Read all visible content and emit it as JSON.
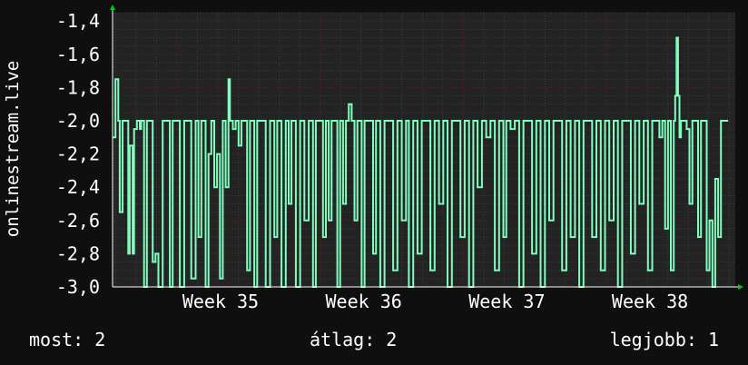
{
  "colors": {
    "background": "#0f0f0f",
    "plot_background": "#232323",
    "grid_major": "#5a1e1e",
    "grid_minor": "#3c3c3c",
    "series": "#7fffbf",
    "axis_arrow": "#00cc00",
    "text": "#ffffff"
  },
  "chart_data": {
    "type": "line",
    "title": "",
    "ylabel": "onlinestream.live",
    "xlabel": "",
    "ylim": [
      -3.0,
      -1.35
    ],
    "yticks": [
      -3.0,
      -2.8,
      -2.6,
      -2.4,
      -2.2,
      -2.0,
      -1.8,
      -1.6,
      -1.4
    ],
    "ytick_labels": [
      "-3,0",
      "-2,8",
      "-2,6",
      "-2,4",
      "-2,2",
      "-2,0",
      "-1,8",
      "-1,6",
      "-1,4"
    ],
    "xlim": [
      34.55,
      38.9
    ],
    "xticks": [
      35,
      36,
      37,
      38
    ],
    "xtick_labels": [
      "Week 35",
      "Week 36",
      "Week 37",
      "Week 38"
    ],
    "grid": true,
    "series": [
      {
        "values": [
          [
            34.55,
            -2.1
          ],
          [
            34.57,
            -1.75
          ],
          [
            34.59,
            -2.0
          ],
          [
            34.6,
            -2.55
          ],
          [
            34.62,
            -2.0
          ],
          [
            34.64,
            -2.0
          ],
          [
            34.66,
            -2.8
          ],
          [
            34.67,
            -2.15
          ],
          [
            34.69,
            -2.8
          ],
          [
            34.7,
            -2.05
          ],
          [
            34.72,
            -2.0
          ],
          [
            34.74,
            -2.05
          ],
          [
            34.75,
            -2.0
          ],
          [
            34.77,
            -3.0
          ],
          [
            34.79,
            -2.0
          ],
          [
            34.81,
            -2.0
          ],
          [
            34.83,
            -2.85
          ],
          [
            34.85,
            -2.8
          ],
          [
            34.87,
            -3.0
          ],
          [
            34.9,
            -2.0
          ],
          [
            34.92,
            -2.0
          ],
          [
            34.95,
            -3.0
          ],
          [
            34.97,
            -2.0
          ],
          [
            35.0,
            -2.0
          ],
          [
            35.02,
            -3.0
          ],
          [
            35.05,
            -2.0
          ],
          [
            35.08,
            -2.0
          ],
          [
            35.1,
            -2.95
          ],
          [
            35.13,
            -2.0
          ],
          [
            35.15,
            -2.7
          ],
          [
            35.17,
            -2.0
          ],
          [
            35.2,
            -3.0
          ],
          [
            35.22,
            -2.2
          ],
          [
            35.24,
            -2.0
          ],
          [
            35.26,
            -2.4
          ],
          [
            35.28,
            -2.2
          ],
          [
            35.3,
            -2.95
          ],
          [
            35.32,
            -2.0
          ],
          [
            35.34,
            -2.4
          ],
          [
            35.36,
            -1.75
          ],
          [
            35.37,
            -2.0
          ],
          [
            35.39,
            -2.05
          ],
          [
            35.41,
            -2.0
          ],
          [
            35.43,
            -2.15
          ],
          [
            35.45,
            -2.0
          ],
          [
            35.47,
            -2.0
          ],
          [
            35.49,
            -2.9
          ],
          [
            35.51,
            -2.0
          ],
          [
            35.54,
            -3.0
          ],
          [
            35.56,
            -2.0
          ],
          [
            35.59,
            -2.0
          ],
          [
            35.62,
            -3.0
          ],
          [
            35.65,
            -2.0
          ],
          [
            35.68,
            -2.7
          ],
          [
            35.7,
            -2.0
          ],
          [
            35.73,
            -3.0
          ],
          [
            35.76,
            -2.0
          ],
          [
            35.78,
            -2.5
          ],
          [
            35.8,
            -2.0
          ],
          [
            35.83,
            -3.0
          ],
          [
            35.86,
            -2.0
          ],
          [
            35.89,
            -2.6
          ],
          [
            35.92,
            -2.0
          ],
          [
            35.95,
            -3.0
          ],
          [
            35.97,
            -2.0
          ],
          [
            36.0,
            -2.0
          ],
          [
            36.02,
            -2.7
          ],
          [
            36.04,
            -2.0
          ],
          [
            36.06,
            -2.6
          ],
          [
            36.08,
            -2.0
          ],
          [
            36.1,
            -2.0
          ],
          [
            36.12,
            -3.0
          ],
          [
            36.14,
            -2.0
          ],
          [
            36.16,
            -2.5
          ],
          [
            36.18,
            -2.0
          ],
          [
            36.2,
            -1.9
          ],
          [
            36.22,
            -2.0
          ],
          [
            36.24,
            -2.6
          ],
          [
            36.26,
            -2.0
          ],
          [
            36.29,
            -3.0
          ],
          [
            36.31,
            -2.0
          ],
          [
            36.34,
            -2.0
          ],
          [
            36.37,
            -2.8
          ],
          [
            36.39,
            -2.0
          ],
          [
            36.42,
            -3.0
          ],
          [
            36.45,
            -2.0
          ],
          [
            36.48,
            -2.0
          ],
          [
            36.51,
            -2.9
          ],
          [
            36.54,
            -2.0
          ],
          [
            36.57,
            -2.6
          ],
          [
            36.6,
            -2.0
          ],
          [
            36.62,
            -3.0
          ],
          [
            36.65,
            -2.0
          ],
          [
            36.68,
            -2.8
          ],
          [
            36.71,
            -2.0
          ],
          [
            36.74,
            -2.0
          ],
          [
            36.77,
            -2.9
          ],
          [
            36.8,
            -2.0
          ],
          [
            36.83,
            -2.5
          ],
          [
            36.86,
            -2.0
          ],
          [
            36.89,
            -3.0
          ],
          [
            36.92,
            -2.0
          ],
          [
            36.95,
            -2.0
          ],
          [
            36.98,
            -2.7
          ],
          [
            37.01,
            -2.0
          ],
          [
            37.04,
            -3.0
          ],
          [
            37.07,
            -2.0
          ],
          [
            37.1,
            -2.4
          ],
          [
            37.13,
            -2.0
          ],
          [
            37.16,
            -2.1
          ],
          [
            37.19,
            -2.0
          ],
          [
            37.22,
            -2.9
          ],
          [
            37.25,
            -2.0
          ],
          [
            37.28,
            -2.7
          ],
          [
            37.3,
            -2.0
          ],
          [
            37.33,
            -2.05
          ],
          [
            37.36,
            -2.0
          ],
          [
            37.39,
            -3.0
          ],
          [
            37.42,
            -2.0
          ],
          [
            37.45,
            -2.0
          ],
          [
            37.48,
            -2.8
          ],
          [
            37.51,
            -2.0
          ],
          [
            37.54,
            -3.0
          ],
          [
            37.57,
            -2.0
          ],
          [
            37.6,
            -2.6
          ],
          [
            37.63,
            -2.0
          ],
          [
            37.66,
            -2.0
          ],
          [
            37.69,
            -2.9
          ],
          [
            37.72,
            -2.0
          ],
          [
            37.75,
            -2.7
          ],
          [
            37.78,
            -2.0
          ],
          [
            37.81,
            -3.0
          ],
          [
            37.84,
            -2.0
          ],
          [
            37.87,
            -2.0
          ],
          [
            37.9,
            -2.7
          ],
          [
            37.93,
            -2.0
          ],
          [
            37.96,
            -2.9
          ],
          [
            37.99,
            -2.0
          ],
          [
            38.02,
            -2.6
          ],
          [
            38.05,
            -2.0
          ],
          [
            38.08,
            -3.0
          ],
          [
            38.11,
            -2.0
          ],
          [
            38.14,
            -2.0
          ],
          [
            38.17,
            -2.8
          ],
          [
            38.2,
            -2.0
          ],
          [
            38.23,
            -2.5
          ],
          [
            38.26,
            -2.0
          ],
          [
            38.29,
            -2.9
          ],
          [
            38.32,
            -2.0
          ],
          [
            38.35,
            -2.0
          ],
          [
            38.37,
            -2.1
          ],
          [
            38.39,
            -2.0
          ],
          [
            38.41,
            -2.65
          ],
          [
            38.43,
            -2.0
          ],
          [
            38.45,
            -2.9
          ],
          [
            38.47,
            -2.0
          ],
          [
            38.48,
            -1.85
          ],
          [
            38.49,
            -1.5
          ],
          [
            38.5,
            -1.85
          ],
          [
            38.51,
            -2.1
          ],
          [
            38.52,
            -2.0
          ],
          [
            38.54,
            -2.0
          ],
          [
            38.56,
            -2.05
          ],
          [
            38.58,
            -2.5
          ],
          [
            38.6,
            -2.0
          ],
          [
            38.62,
            -2.0
          ],
          [
            38.64,
            -2.7
          ],
          [
            38.66,
            -2.0
          ],
          [
            38.68,
            -2.0
          ],
          [
            38.7,
            -2.9
          ],
          [
            38.72,
            -2.6
          ],
          [
            38.74,
            -3.0
          ],
          [
            38.76,
            -2.35
          ],
          [
            38.78,
            -2.7
          ],
          [
            38.8,
            -2.0
          ],
          [
            38.85,
            -2.0
          ]
        ]
      }
    ]
  },
  "footer": {
    "most": "most: 2",
    "average": "átlag: 2",
    "best": "legjobb: 1"
  }
}
